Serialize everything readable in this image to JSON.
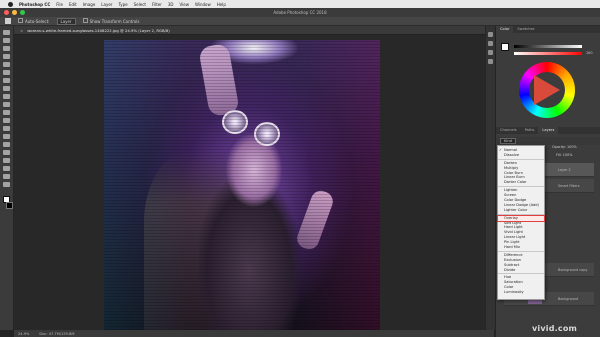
{
  "mac_menubar": {
    "app_name": "Photoshop CC",
    "menus": [
      "File",
      "Edit",
      "Image",
      "Layer",
      "Type",
      "Select",
      "Filter",
      "3D",
      "View",
      "Window",
      "Help"
    ]
  },
  "titlebar": {
    "title": "Adobe Photoshop CC 2018"
  },
  "options_bar": {
    "auto_select_label": "Auto-Select:",
    "auto_select_value": "Layer",
    "transform_label": "Show Transform Controls"
  },
  "doc_tab": {
    "label": "woman-s-white-framed-sunglasses-1408222.jpg @ 24.9% (Layer 2, RGB/8)"
  },
  "status_bar": {
    "zoom": "24.9%",
    "doc_size": "Doc: 47.7M/159.8M"
  },
  "color_panel": {
    "tabs": [
      "Color",
      "Swatches"
    ],
    "slider_value": "100"
  },
  "layers_panel": {
    "tabs": [
      "Channels",
      "Paths",
      "Layers"
    ],
    "kind_label": "Kind",
    "opacity_label": "Opacity:",
    "opacity_value": "100%",
    "fill_label": "Fill:",
    "fill_value": "100%",
    "layers": [
      {
        "label": "Layer 2"
      },
      {
        "label": "Smart Filters"
      },
      {
        "label": "Background copy"
      },
      {
        "label": "Background"
      }
    ]
  },
  "blend_modes": {
    "groups": [
      [
        "Normal",
        "Dissolve"
      ],
      [
        "Darken",
        "Multiply",
        "Color Burn",
        "Linear Burn",
        "Darker Color"
      ],
      [
        "Lighten",
        "Screen",
        "Color Dodge",
        "Linear Dodge (Add)",
        "Lighter Color"
      ],
      [
        "Overlay",
        "Soft Light",
        "Hard Light",
        "Vivid Light",
        "Linear Light",
        "Pin Light",
        "Hard Mix"
      ],
      [
        "Difference",
        "Exclusion",
        "Subtract",
        "Divide"
      ],
      [
        "Hue",
        "Saturation",
        "Color",
        "Luminosity"
      ]
    ],
    "checked": "Normal",
    "highlighted": "Overlay"
  },
  "watermark": {
    "text": "vivid.com"
  },
  "colors": {
    "accent_highlight": "#e04040",
    "ui_dark": "#3c3c3c"
  }
}
